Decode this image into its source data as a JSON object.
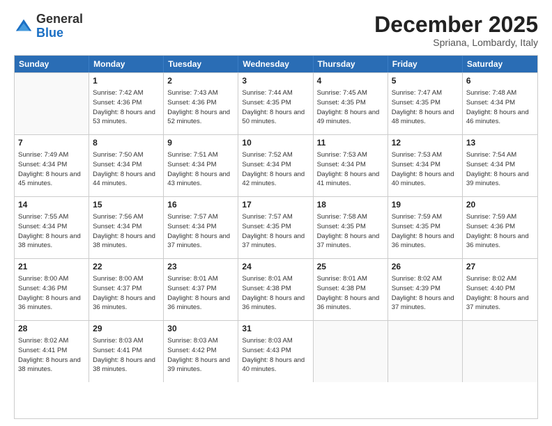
{
  "logo": {
    "general": "General",
    "blue": "Blue"
  },
  "title": "December 2025",
  "location": "Spriana, Lombardy, Italy",
  "header_days": [
    "Sunday",
    "Monday",
    "Tuesday",
    "Wednesday",
    "Thursday",
    "Friday",
    "Saturday"
  ],
  "weeks": [
    [
      {
        "day": "",
        "sunrise": "",
        "sunset": "",
        "daylight": ""
      },
      {
        "day": "1",
        "sunrise": "Sunrise: 7:42 AM",
        "sunset": "Sunset: 4:36 PM",
        "daylight": "Daylight: 8 hours and 53 minutes."
      },
      {
        "day": "2",
        "sunrise": "Sunrise: 7:43 AM",
        "sunset": "Sunset: 4:36 PM",
        "daylight": "Daylight: 8 hours and 52 minutes."
      },
      {
        "day": "3",
        "sunrise": "Sunrise: 7:44 AM",
        "sunset": "Sunset: 4:35 PM",
        "daylight": "Daylight: 8 hours and 50 minutes."
      },
      {
        "day": "4",
        "sunrise": "Sunrise: 7:45 AM",
        "sunset": "Sunset: 4:35 PM",
        "daylight": "Daylight: 8 hours and 49 minutes."
      },
      {
        "day": "5",
        "sunrise": "Sunrise: 7:47 AM",
        "sunset": "Sunset: 4:35 PM",
        "daylight": "Daylight: 8 hours and 48 minutes."
      },
      {
        "day": "6",
        "sunrise": "Sunrise: 7:48 AM",
        "sunset": "Sunset: 4:34 PM",
        "daylight": "Daylight: 8 hours and 46 minutes."
      }
    ],
    [
      {
        "day": "7",
        "sunrise": "Sunrise: 7:49 AM",
        "sunset": "Sunset: 4:34 PM",
        "daylight": "Daylight: 8 hours and 45 minutes."
      },
      {
        "day": "8",
        "sunrise": "Sunrise: 7:50 AM",
        "sunset": "Sunset: 4:34 PM",
        "daylight": "Daylight: 8 hours and 44 minutes."
      },
      {
        "day": "9",
        "sunrise": "Sunrise: 7:51 AM",
        "sunset": "Sunset: 4:34 PM",
        "daylight": "Daylight: 8 hours and 43 minutes."
      },
      {
        "day": "10",
        "sunrise": "Sunrise: 7:52 AM",
        "sunset": "Sunset: 4:34 PM",
        "daylight": "Daylight: 8 hours and 42 minutes."
      },
      {
        "day": "11",
        "sunrise": "Sunrise: 7:53 AM",
        "sunset": "Sunset: 4:34 PM",
        "daylight": "Daylight: 8 hours and 41 minutes."
      },
      {
        "day": "12",
        "sunrise": "Sunrise: 7:53 AM",
        "sunset": "Sunset: 4:34 PM",
        "daylight": "Daylight: 8 hours and 40 minutes."
      },
      {
        "day": "13",
        "sunrise": "Sunrise: 7:54 AM",
        "sunset": "Sunset: 4:34 PM",
        "daylight": "Daylight: 8 hours and 39 minutes."
      }
    ],
    [
      {
        "day": "14",
        "sunrise": "Sunrise: 7:55 AM",
        "sunset": "Sunset: 4:34 PM",
        "daylight": "Daylight: 8 hours and 38 minutes."
      },
      {
        "day": "15",
        "sunrise": "Sunrise: 7:56 AM",
        "sunset": "Sunset: 4:34 PM",
        "daylight": "Daylight: 8 hours and 38 minutes."
      },
      {
        "day": "16",
        "sunrise": "Sunrise: 7:57 AM",
        "sunset": "Sunset: 4:34 PM",
        "daylight": "Daylight: 8 hours and 37 minutes."
      },
      {
        "day": "17",
        "sunrise": "Sunrise: 7:57 AM",
        "sunset": "Sunset: 4:35 PM",
        "daylight": "Daylight: 8 hours and 37 minutes."
      },
      {
        "day": "18",
        "sunrise": "Sunrise: 7:58 AM",
        "sunset": "Sunset: 4:35 PM",
        "daylight": "Daylight: 8 hours and 37 minutes."
      },
      {
        "day": "19",
        "sunrise": "Sunrise: 7:59 AM",
        "sunset": "Sunset: 4:35 PM",
        "daylight": "Daylight: 8 hours and 36 minutes."
      },
      {
        "day": "20",
        "sunrise": "Sunrise: 7:59 AM",
        "sunset": "Sunset: 4:36 PM",
        "daylight": "Daylight: 8 hours and 36 minutes."
      }
    ],
    [
      {
        "day": "21",
        "sunrise": "Sunrise: 8:00 AM",
        "sunset": "Sunset: 4:36 PM",
        "daylight": "Daylight: 8 hours and 36 minutes."
      },
      {
        "day": "22",
        "sunrise": "Sunrise: 8:00 AM",
        "sunset": "Sunset: 4:37 PM",
        "daylight": "Daylight: 8 hours and 36 minutes."
      },
      {
        "day": "23",
        "sunrise": "Sunrise: 8:01 AM",
        "sunset": "Sunset: 4:37 PM",
        "daylight": "Daylight: 8 hours and 36 minutes."
      },
      {
        "day": "24",
        "sunrise": "Sunrise: 8:01 AM",
        "sunset": "Sunset: 4:38 PM",
        "daylight": "Daylight: 8 hours and 36 minutes."
      },
      {
        "day": "25",
        "sunrise": "Sunrise: 8:01 AM",
        "sunset": "Sunset: 4:38 PM",
        "daylight": "Daylight: 8 hours and 36 minutes."
      },
      {
        "day": "26",
        "sunrise": "Sunrise: 8:02 AM",
        "sunset": "Sunset: 4:39 PM",
        "daylight": "Daylight: 8 hours and 37 minutes."
      },
      {
        "day": "27",
        "sunrise": "Sunrise: 8:02 AM",
        "sunset": "Sunset: 4:40 PM",
        "daylight": "Daylight: 8 hours and 37 minutes."
      }
    ],
    [
      {
        "day": "28",
        "sunrise": "Sunrise: 8:02 AM",
        "sunset": "Sunset: 4:41 PM",
        "daylight": "Daylight: 8 hours and 38 minutes."
      },
      {
        "day": "29",
        "sunrise": "Sunrise: 8:03 AM",
        "sunset": "Sunset: 4:41 PM",
        "daylight": "Daylight: 8 hours and 38 minutes."
      },
      {
        "day": "30",
        "sunrise": "Sunrise: 8:03 AM",
        "sunset": "Sunset: 4:42 PM",
        "daylight": "Daylight: 8 hours and 39 minutes."
      },
      {
        "day": "31",
        "sunrise": "Sunrise: 8:03 AM",
        "sunset": "Sunset: 4:43 PM",
        "daylight": "Daylight: 8 hours and 40 minutes."
      },
      {
        "day": "",
        "sunrise": "",
        "sunset": "",
        "daylight": ""
      },
      {
        "day": "",
        "sunrise": "",
        "sunset": "",
        "daylight": ""
      },
      {
        "day": "",
        "sunrise": "",
        "sunset": "",
        "daylight": ""
      }
    ]
  ]
}
